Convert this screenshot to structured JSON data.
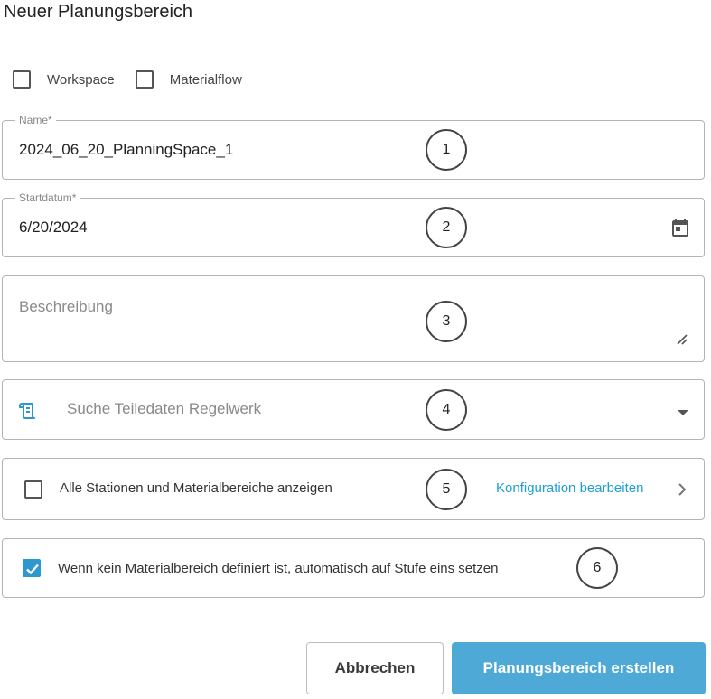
{
  "dialog": {
    "title": "Neuer Planungsbereich"
  },
  "type_options": [
    {
      "label": "Workspace",
      "checked": false
    },
    {
      "label": "Materialflow",
      "checked": false
    }
  ],
  "fields": {
    "name": {
      "label": "Name*",
      "value": "2024_06_20_PlanningSpace_1"
    },
    "startdate": {
      "label": "Startdatum*",
      "value": "6/20/2024",
      "icon": "calendar-icon"
    },
    "description": {
      "placeholder": "Beschreibung",
      "icon": "resize-handle-icon"
    },
    "ruleset": {
      "placeholder": "Suche Teiledaten Regelwerk",
      "icon": "scroll-icon",
      "dropdown_icon": "caret-down-icon"
    }
  },
  "options": {
    "show_all": {
      "label": "Alle Stationen und Materialbereiche anzeigen",
      "checked": false,
      "link": "Konfiguration bearbeiten",
      "link_icon": "chevron-right-icon"
    },
    "auto_level": {
      "label": "Wenn kein Materialbereich definiert ist, automatisch auf Stufe eins setzen",
      "checked": true
    }
  },
  "markers": [
    "1",
    "2",
    "3",
    "4",
    "5",
    "6"
  ],
  "buttons": {
    "cancel": "Abbrechen",
    "create": "Planungsbereich erstellen"
  },
  "colors": {
    "accent": "#2d97cf",
    "primary_button": "#4fa9d6",
    "link": "#1ea0d2",
    "border": "#b4b4b4"
  }
}
